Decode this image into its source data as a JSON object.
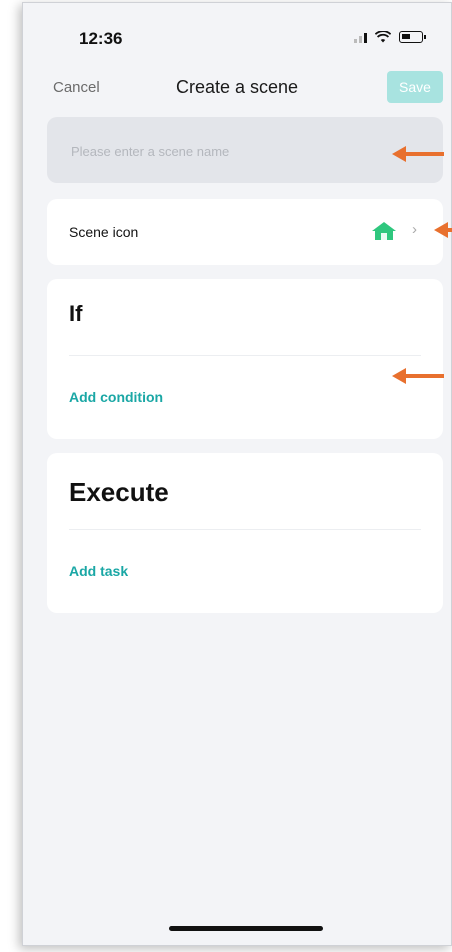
{
  "status_bar": {
    "time": "12:36"
  },
  "nav": {
    "cancel_label": "Cancel",
    "title": "Create a scene",
    "save_label": "Save"
  },
  "scene_name": {
    "placeholder": "Please enter a scene name",
    "value": ""
  },
  "scene_icon": {
    "label": "Scene icon",
    "icon": "home-icon",
    "icon_color": "#2fc77e"
  },
  "if_section": {
    "title": "If",
    "add_label": "Add condition"
  },
  "execute_section": {
    "title": "Execute",
    "add_label": "Add task"
  },
  "colors": {
    "accent": "#1aa7a5",
    "save_disabled": "#a8e3e0",
    "annotation_arrow": "#e8702e"
  }
}
